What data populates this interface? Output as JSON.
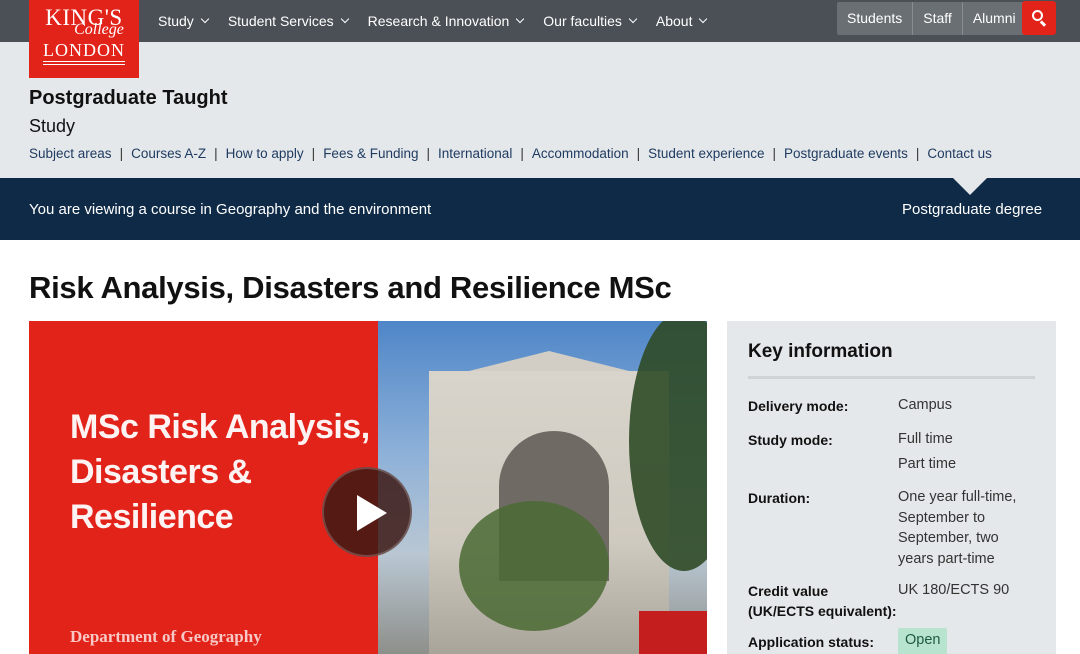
{
  "logo": {
    "line1": "KING'S",
    "line2": "College",
    "line3": "LONDON"
  },
  "nav": {
    "items": [
      {
        "label": "Study"
      },
      {
        "label": "Student Services"
      },
      {
        "label": "Research & Innovation"
      },
      {
        "label": "Our faculties"
      },
      {
        "label": "About"
      }
    ],
    "audience": [
      {
        "label": "Students"
      },
      {
        "label": "Staff"
      },
      {
        "label": "Alumni"
      }
    ]
  },
  "section": {
    "title": "Postgraduate Taught",
    "subtitle": "Study",
    "links": [
      "Subject areas",
      "Courses A-Z",
      "How to apply",
      "Fees & Funding",
      "International",
      "Accommodation",
      "Student experience",
      "Postgraduate events",
      "Contact us"
    ]
  },
  "banner": {
    "viewing": "You are viewing a course in Geography and the environment",
    "degree": "Postgraduate degree"
  },
  "course": {
    "title": "Risk Analysis, Disasters and Resilience MSc"
  },
  "video": {
    "title_lines": [
      "MSc Risk Analysis,",
      "Disasters &",
      "Resilience"
    ],
    "department": "Department of Geography"
  },
  "key_info": {
    "title": "Key information",
    "delivery_label": "Delivery mode:",
    "delivery_value": "Campus",
    "study_label": "Study mode:",
    "study_value_1": "Full time",
    "study_value_2": "Part time",
    "duration_label": "Duration:",
    "duration_lines": [
      "One year full-time,",
      "September to",
      "September, two",
      "years part-time"
    ],
    "credit_label_1": "Credit value",
    "credit_label_2": "(UK/ECTS equivalent):",
    "credit_value": "UK 180/ECTS 90",
    "application_label": "Application status:",
    "application_value": "Open"
  },
  "colors": {
    "brand_red": "#e2231a",
    "navy": "#0e2a47",
    "topbar": "#4b5056",
    "section_bg": "#e5e8ea",
    "open_badge": "#b8e4cf"
  },
  "icons": {
    "search": "search-icon",
    "chevron": "chevron-down-icon",
    "play": "play-icon"
  }
}
